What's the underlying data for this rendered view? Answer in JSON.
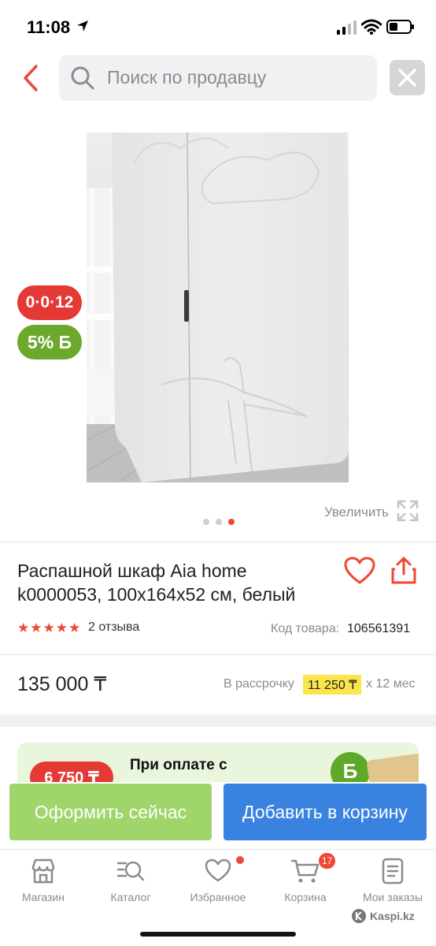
{
  "status": {
    "time": "11:08"
  },
  "search": {
    "placeholder": "Поиск по продавцу"
  },
  "badges": {
    "installment": "0·0·12",
    "bonus": "5% Б"
  },
  "gallery": {
    "zoom_label": "Увеличить",
    "dot_count": 3,
    "active_index": 2
  },
  "product": {
    "title": "Распашной шкаф Aia home k0000053, 100х164х52 см, белый",
    "rating": 5,
    "reviews": "2 отзыва",
    "code_label": "Код товара:",
    "code_value": "106561391",
    "price": "135 000 ₸",
    "installment_label": "В рассрочку",
    "installment_amount": "11 250 ₸",
    "installment_period": "х 12 мес"
  },
  "promo": {
    "badge": "6 750 ₸",
    "text": "При оплате с",
    "b_icon": "Б"
  },
  "actions": {
    "order": "Оформить сейчас",
    "add_to_cart": "Добавить в корзину"
  },
  "tabs": [
    {
      "label": "Магазин",
      "icon": "shop-icon"
    },
    {
      "label": "Каталог",
      "icon": "catalog-icon"
    },
    {
      "label": "Избранное",
      "icon": "heart-icon"
    },
    {
      "label": "Корзина",
      "icon": "cart-icon",
      "count": "17"
    },
    {
      "label": "Мои заказы",
      "icon": "orders-icon"
    }
  ],
  "watermark": "Kaspi.kz",
  "colors": {
    "accent_red": "#f14635",
    "green": "#9fd56b",
    "blue": "#3a82e0",
    "yellow": "#fbe54b"
  }
}
